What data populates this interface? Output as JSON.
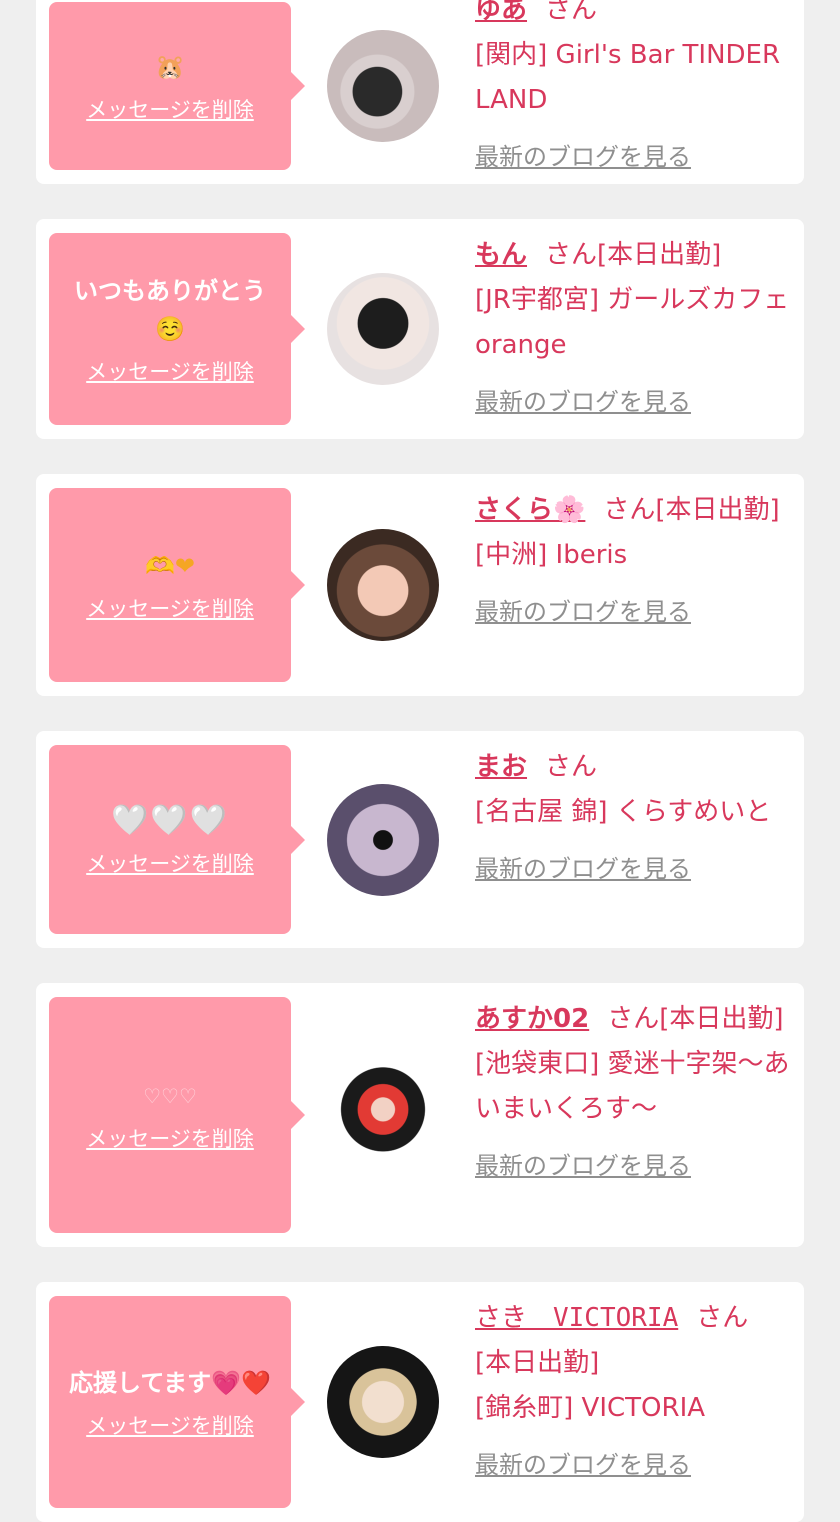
{
  "cards": [
    {
      "message": "🐹",
      "delete_label": "メッセージを削除",
      "name": "ゆあ",
      "honorific": "さん",
      "status": "",
      "shop": "[関内] Girl's Bar TINDER LAND",
      "blog_label": "最新のブログを見る"
    },
    {
      "message": "いつもありがとう☺️",
      "delete_label": "メッセージを削除",
      "name": "もん",
      "honorific": "さん",
      "status": "[本日出勤]",
      "shop": "[JR宇都宮] ガールズカフェ orange",
      "blog_label": "最新のブログを見る"
    },
    {
      "message": "🫶❤",
      "delete_label": "メッセージを削除",
      "name": "さくら🌸",
      "honorific": "さん",
      "status": "[本日出勤]",
      "shop": "[中洲] Iberis",
      "blog_label": "最新のブログを見る"
    },
    {
      "message": "🤍🤍🤍",
      "delete_label": "メッセージを削除",
      "name": "まお",
      "honorific": "さん",
      "status": "",
      "shop": "[名古屋 錦] くらすめいと",
      "blog_label": "最新のブログを見る"
    },
    {
      "message": "♡♡♡",
      "delete_label": "メッセージを削除",
      "name": "あすか02",
      "honorific": "さん",
      "status": "[本日出勤]",
      "shop": "[池袋東口] 愛迷十字架～あいまいくろす～",
      "blog_label": "最新のブログを見る"
    },
    {
      "message": "応援してます💗❤️",
      "delete_label": "メッセージを削除",
      "name": "さき　VICTORIA",
      "honorific": "さん",
      "status": "[本日出勤]",
      "shop": "[錦糸町] VICTORIA",
      "blog_label": "最新のブログを見る"
    }
  ],
  "colors": {
    "page_bg": "#efefef",
    "card_bg": "#ffffff",
    "bubble_bg": "#ff9aaa",
    "accent": "#d8385c",
    "muted_link": "#8f8f8f"
  }
}
